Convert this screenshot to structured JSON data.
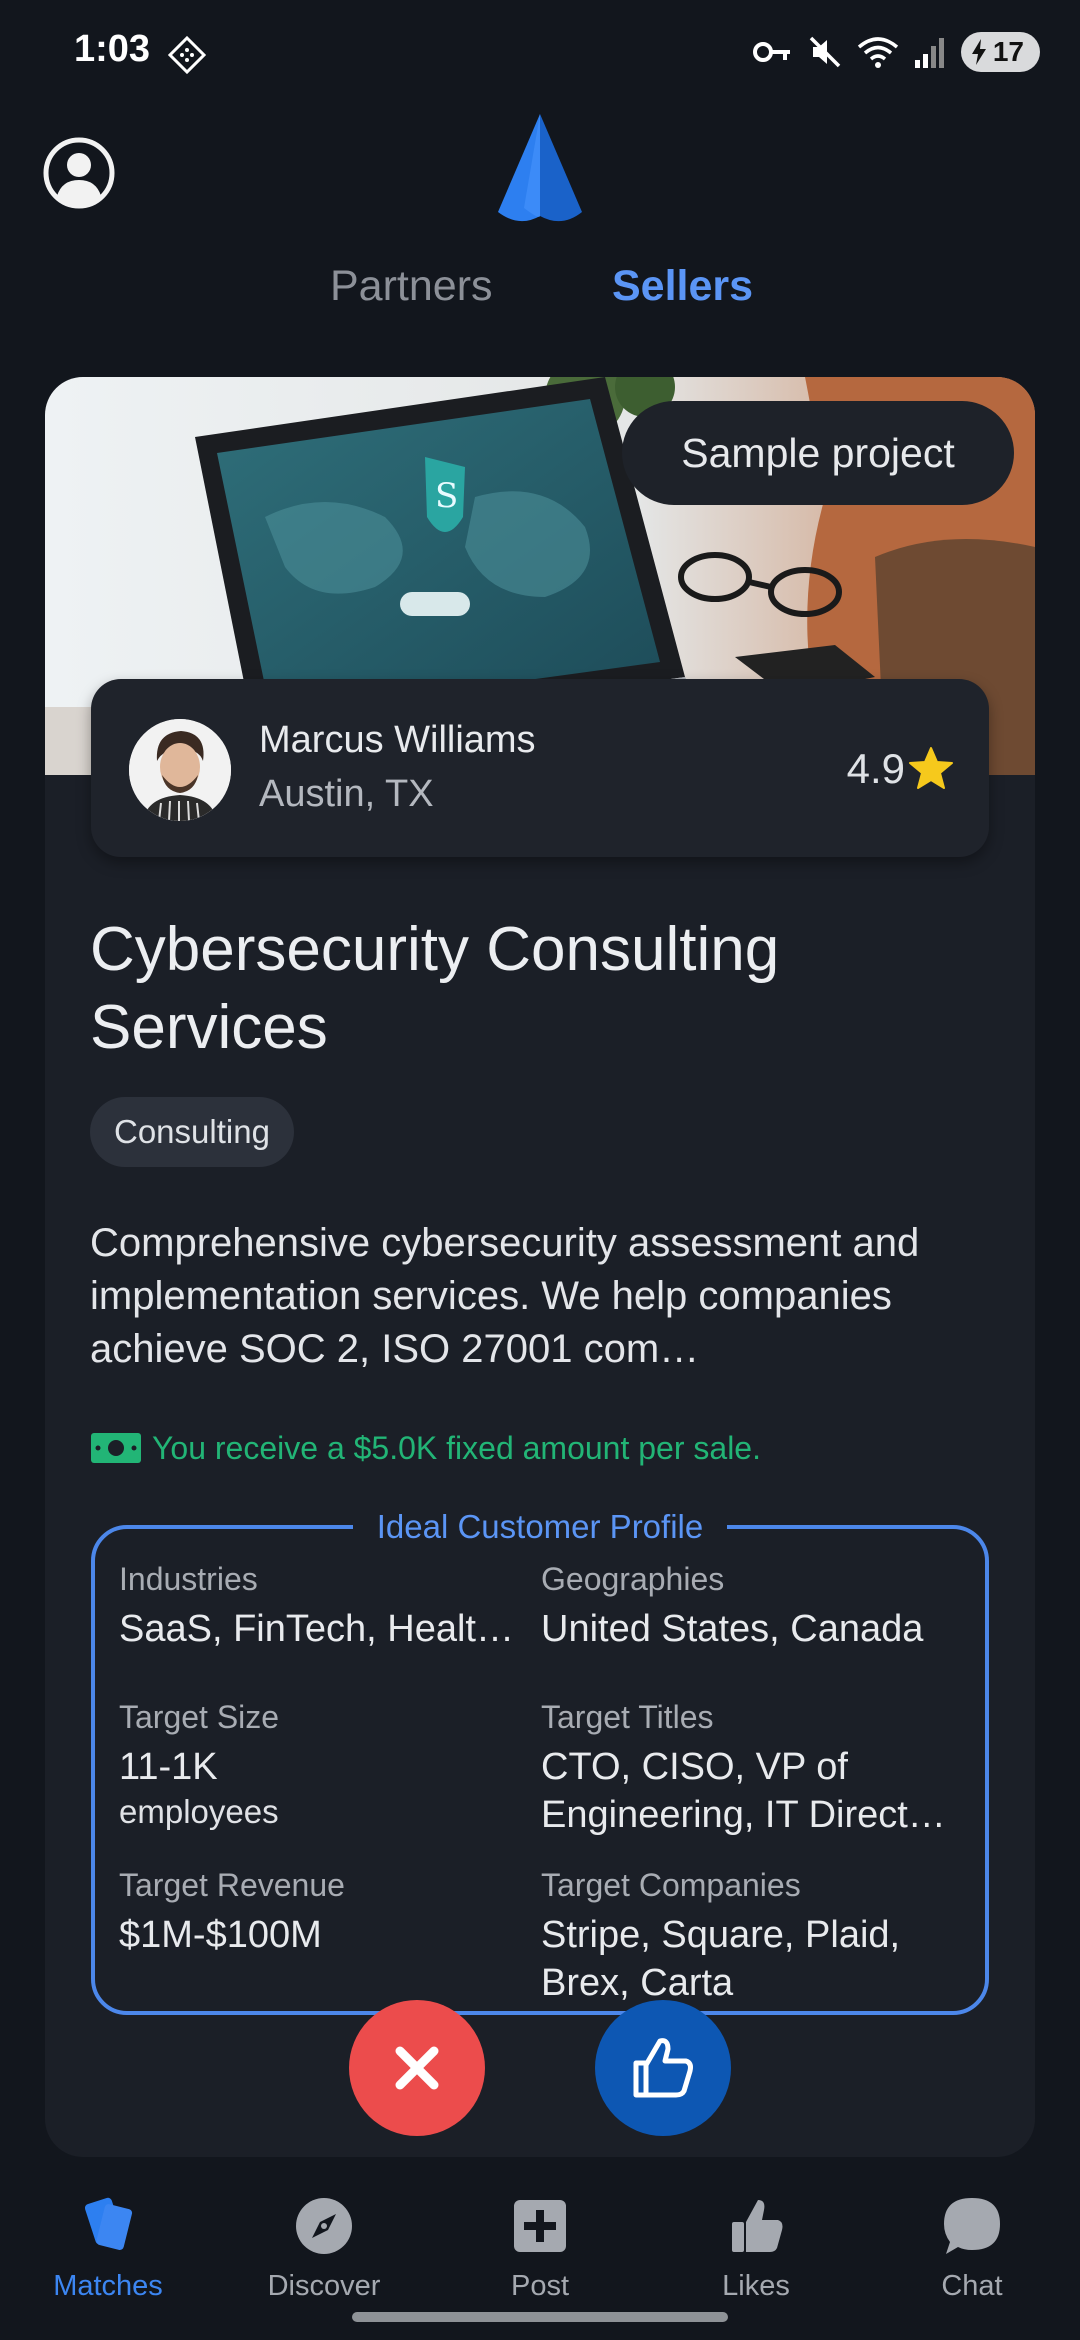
{
  "status_bar": {
    "time": "1:03",
    "battery": "17"
  },
  "header": {
    "tabs": [
      {
        "label": "Partners",
        "active": false
      },
      {
        "label": "Sellers",
        "active": true
      }
    ]
  },
  "card": {
    "badge": "Sample project",
    "seller": {
      "name": "Marcus Williams",
      "location": "Austin, TX",
      "rating": "4.9"
    },
    "title": "Cybersecurity Consulting Services",
    "category": "Consulting",
    "description": "Comprehensive cybersecurity assessment and implementation services. We help companies achieve SOC 2, ISO 27001 com…",
    "commission": "You receive a $5.0K fixed amount per sale.",
    "icp": {
      "legend": "Ideal Customer Profile",
      "industries_label": "Industries",
      "industries_value": "SaaS, FinTech, Health…",
      "geographies_label": "Geographies",
      "geographies_value": "United States, Canada",
      "target_size_label": "Target Size",
      "target_size_value": "11-1K",
      "target_size_unit": "employees",
      "target_titles_label": "Target Titles",
      "target_titles_value": "CTO, CISO, VP of Engineering, IT Direct…",
      "target_revenue_label": "Target Revenue",
      "target_revenue_value": "$1M-$100M",
      "target_companies_label": "Target Companies",
      "target_companies_value": "Stripe, Square, Plaid, Brex, Carta"
    }
  },
  "bottom_nav": [
    {
      "label": "Matches",
      "icon": "cards-icon",
      "active": true
    },
    {
      "label": "Discover",
      "icon": "compass-icon",
      "active": false
    },
    {
      "label": "Post",
      "icon": "plus-square-icon",
      "active": false
    },
    {
      "label": "Likes",
      "icon": "thumbs-up-icon",
      "active": false
    },
    {
      "label": "Chat",
      "icon": "chat-bubble-icon",
      "active": false
    }
  ],
  "colors": {
    "background": "#12161d",
    "card": "#1b1f27",
    "accent": "#5b95f5",
    "commission_green": "#22b576",
    "reject_red": "#ec4c4c",
    "like_blue": "#0d57b3"
  }
}
